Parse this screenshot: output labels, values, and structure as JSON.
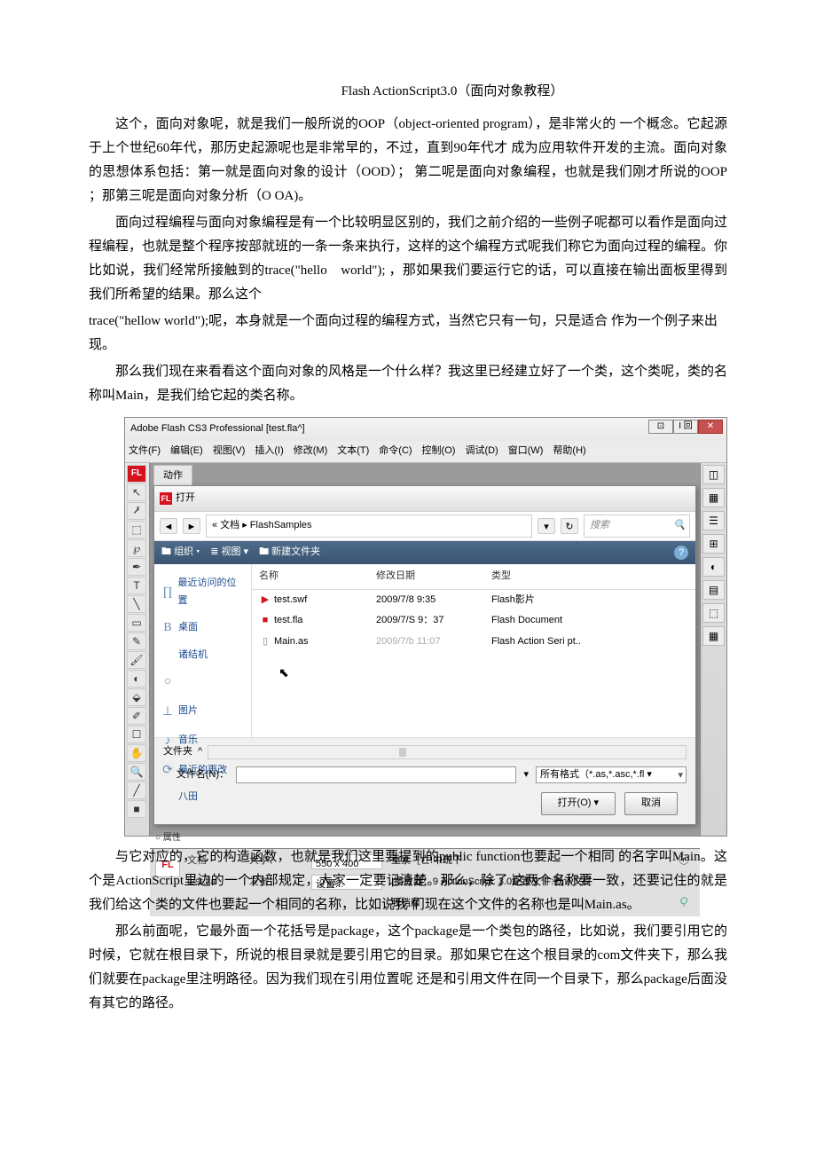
{
  "title": "Flash ActionScript3.0（面向对象教程）",
  "paragraphs": {
    "p1": "这个，面向对象呢，就是我们一般所说的OOP（object-oriented program），是非常火的 一个概念。它起源于上个世纪60年代，那历史起源呢也是非常早的，不过，直到90年代才 成为应用软件开发的主流。面向对象的思想体系包括：第一就是面向对象的设计（OOD）； 第二呢是面向对象编程，也就是我们刚才所说的OOP ；那第三呢是面向对象分析（O OA)。",
    "p2": "面向过程编程与面向对象编程是有一个比较明显区别的，我们之前介绍的一些例子呢都可以看作是面向过程编程，也就是整个程序按部就班的一条一条来执行，这样的这个编程方式呢我们称它为面向过程的编程。你比如说，我们经常所接触到的trace(\"hello　world\"); ，那如果我们要运行它的话，可以直接在输出面板里得到我们所希望的结果。那么这个",
    "p2b": "trace(\"hellow world\");呢，本身就是一个面向过程的编程方式，当然它只有一句，只是适合 作为一个例子来出现。",
    "p3": "那么我们现在来看看这个面向对象的风格是一个什么样？我这里已经建立好了一个类，这个类呢，类的名称叫Main，是我们给它起的类名称。",
    "p4": "与它对应的，它的构造函数，也就是我们这里要提到的public function也要起一个相同 的名字叫Main。这个是ActionScript里边的一个内部规定，大家一定要记清楚。那么，除了 这两个名称要一致，还要记住的就是我们给这个类的文件也要起一个相同的名称，比如说我 们现在这个文件的名称也是叫Main.as。",
    "p5": "那么前面呢，它最外面一个花括号是package，这个package是一个类包的路径，比如说，我们要引用它的时候，它就在根目录下，所说的根目录就是要引用它的目录。那如果它在这个根目录的com文件夹下，那么我们就要在package里注明路径。因为我们现在引用位置呢 还是和引用文件在同一个目录下，那么package后面没有其它的路径。"
  },
  "app": {
    "title": "Adobe Flash CS3 Professional [test.fla^]",
    "menubar": "文件(F)　编辑(E)　视图(V)　插入(I)　修改(M)　文本(T)　命令(C)　控制(O)　调试(D)　窗口(W)　帮助(H)",
    "winControls": {
      "min": "⊡",
      "max": "I 回",
      "close": "✕"
    },
    "tabLabel": "动作",
    "dialog": {
      "title": "打开",
      "breadcrumb": "« 文档 ▸ FlashSamples",
      "searchPlaceholder": "搜索",
      "toolbar": {
        "org": "组织 ▾",
        "view": "≣ 视图 ▾",
        "newFolder": "新建文件夹"
      },
      "headers": {
        "name": "名称",
        "date": "修改日期",
        "type": "类型"
      },
      "places": [
        {
          "icon": "∏",
          "label": "最近访问的位置"
        },
        {
          "icon": "B",
          "label": "桌面"
        },
        {
          "icon": "",
          "label": "诸结机"
        },
        {
          "icon": "○",
          "label": ""
        },
        {
          "icon": "⊥",
          "label": "图片"
        },
        {
          "icon": "♪",
          "label": "音乐"
        },
        {
          "icon": "⟳",
          "label": "最近的更改"
        },
        {
          "icon": "",
          "label": "八田"
        }
      ],
      "files": [
        {
          "icon": "swf",
          "name": "test.swf",
          "date": "2009/7/8 9:35",
          "type": "Flash影片"
        },
        {
          "icon": "fla",
          "name": "test.fla",
          "date": "2009/7/S 9：37",
          "type": "Flash Document"
        },
        {
          "icon": "as",
          "name": "Main.as",
          "date": "2009/7/b 11:07",
          "type": "Flash Action Seri pt.."
        }
      ],
      "fileFolderLabel": "文件夹",
      "filenameLabel": "文件名(N)：",
      "filenameValue": "",
      "filterValue": "所有格式（*.as,*.asc,*.fl ▾",
      "openBtn": "打开(O)",
      "cancelBtn": "取消"
    },
    "props": {
      "docLabel": "文档",
      "docName": "test.fla",
      "sizeLabel": "大小：",
      "sizeValue": "550 x 400",
      "sizeExtra": "重素［亡!中疏下",
      "publishLabel": "发布：",
      "publishBtn": "设置...",
      "playerInfo": "|播放器：9 ActionScript: 3.0配置文件:默认文件",
      "myDocs": "我档靡"
    },
    "rightIcons": [
      "◫",
      "▦",
      "☰",
      "⊞",
      "◐",
      "▤",
      "⬚",
      "▦"
    ]
  }
}
